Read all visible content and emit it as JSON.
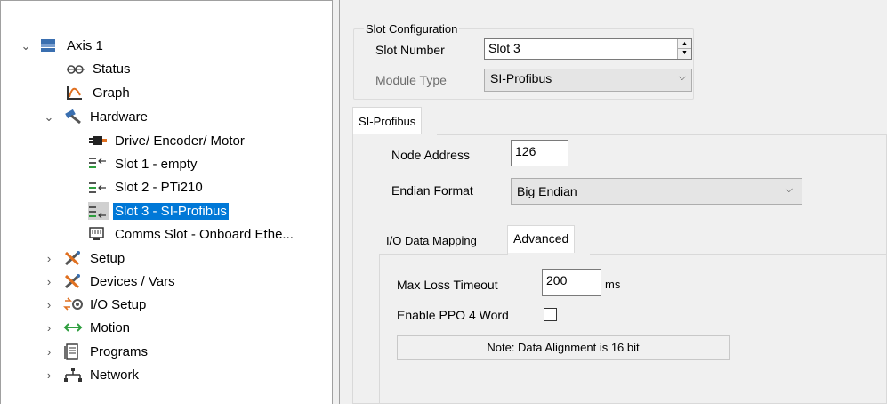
{
  "tree": {
    "items": [
      {
        "label": "Axis 1",
        "icon": "axis-icon",
        "expanded": true
      },
      {
        "label": "Status",
        "icon": "status-icon"
      },
      {
        "label": "Graph",
        "icon": "graph-icon"
      },
      {
        "label": "Hardware",
        "icon": "hammer-icon",
        "expanded": true
      },
      {
        "label": "Drive/ Encoder/ Motor",
        "icon": "drive-icon"
      },
      {
        "label": "Slot 1 - empty",
        "icon": "slot-icon"
      },
      {
        "label": "Slot 2 - PTi210",
        "icon": "slot-icon"
      },
      {
        "label": "Slot 3 - SI-Profibus",
        "icon": "slot-icon",
        "selected": true
      },
      {
        "label": "Comms Slot - Onboard Ethe...",
        "icon": "network-port-icon"
      },
      {
        "label": "Setup",
        "icon": "tools-icon"
      },
      {
        "label": "Devices / Vars",
        "icon": "tools-icon"
      },
      {
        "label": "I/O Setup",
        "icon": "io-icon"
      },
      {
        "label": "Motion",
        "icon": "motion-arrows-icon"
      },
      {
        "label": "Programs",
        "icon": "programs-icon"
      },
      {
        "label": "Network",
        "icon": "network-icon"
      }
    ]
  },
  "slot_config": {
    "legend": "Slot Configuration",
    "slot_number_label": "Slot Number",
    "slot_number_value": "Slot 3",
    "module_type_label": "Module Type",
    "module_type_value": "SI-Profibus"
  },
  "tabs": {
    "main_tab": "SI-Profibus",
    "sub_tab_1": "I/O Data Mapping",
    "sub_tab_2": "Advanced"
  },
  "profibus": {
    "node_address_label": "Node Address",
    "node_address_value": "126",
    "endian_label": "Endian Format",
    "endian_value": "Big Endian"
  },
  "advanced": {
    "max_loss_label": "Max Loss Timeout",
    "max_loss_value": "200",
    "max_loss_unit": "ms",
    "ppo4_label": "Enable PPO 4 Word",
    "ppo4_checked": false,
    "note": "Note: Data Alignment is 16 bit"
  },
  "colors": {
    "selection": "#0078d7",
    "accent_green": "#2e9e3e",
    "accent_orange": "#e07020",
    "accent_red": "#d03030"
  }
}
